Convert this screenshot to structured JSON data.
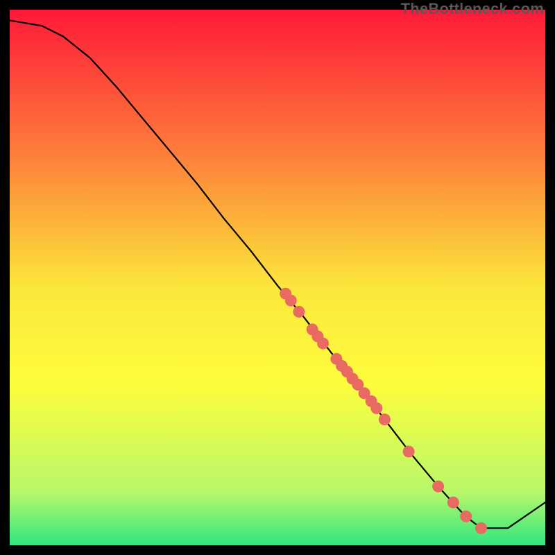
{
  "attribution": "TheBottleneck.com",
  "colors": {
    "bg": "#000000",
    "curve": "#000000",
    "curve_light": "#333333",
    "dots": "#e86a62",
    "grad_top": "#fe1938",
    "grad_mid_upper": "#fd7b3a",
    "grad_mid": "#fce73b",
    "grad_yellow": "#fdfd3c",
    "grad_lt_green": "#b8f86b",
    "grad_green": "#31e67e"
  },
  "chart_data": {
    "type": "line",
    "title": "",
    "xlabel": "",
    "ylabel": "",
    "xlim": [
      0,
      100
    ],
    "ylim": [
      0,
      100
    ],
    "x": [
      0,
      6,
      10,
      15,
      20,
      25,
      30,
      35,
      40,
      45,
      50,
      55,
      60,
      65,
      70,
      75,
      80,
      85,
      88,
      93,
      100
    ],
    "y": [
      98,
      97,
      95,
      91,
      85.5,
      79.5,
      73.5,
      67.5,
      61,
      55,
      48.5,
      42.5,
      36,
      30,
      23.5,
      17,
      11,
      5.5,
      3.2,
      3.2,
      8
    ],
    "series": [
      {
        "name": "dots",
        "points": [
          {
            "x": 51.5,
            "y": 47.0
          },
          {
            "x": 52.5,
            "y": 45.7
          },
          {
            "x": 54.0,
            "y": 43.6
          },
          {
            "x": 56.5,
            "y": 40.3
          },
          {
            "x": 57.5,
            "y": 39.0
          },
          {
            "x": 58.5,
            "y": 37.7
          },
          {
            "x": 61.0,
            "y": 34.8
          },
          {
            "x": 62.0,
            "y": 33.5
          },
          {
            "x": 63.0,
            "y": 32.4
          },
          {
            "x": 64.0,
            "y": 31.1
          },
          {
            "x": 65.0,
            "y": 30.0
          },
          {
            "x": 66.2,
            "y": 28.4
          },
          {
            "x": 67.5,
            "y": 26.9
          },
          {
            "x": 68.5,
            "y": 25.6
          },
          {
            "x": 70.0,
            "y": 23.5
          },
          {
            "x": 74.5,
            "y": 17.5
          },
          {
            "x": 80.0,
            "y": 11.0
          },
          {
            "x": 82.8,
            "y": 8.0
          },
          {
            "x": 85.2,
            "y": 5.4
          },
          {
            "x": 88.0,
            "y": 3.2
          }
        ]
      }
    ]
  }
}
